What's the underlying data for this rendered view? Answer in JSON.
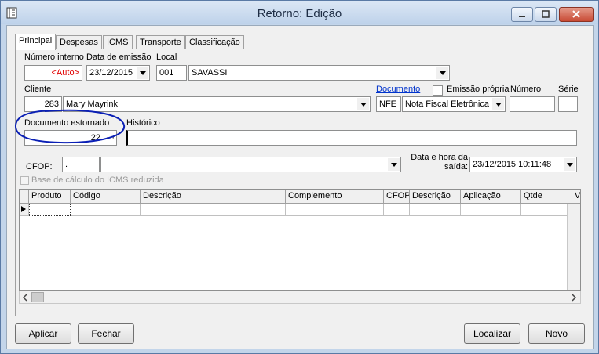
{
  "window": {
    "title": "Retorno: Edição"
  },
  "tabs": [
    "Principal",
    "Despesas",
    "ICMS",
    "Transporte",
    "Classificação"
  ],
  "form": {
    "numero_interno_label": "Número interno",
    "numero_interno_value": "<Auto>",
    "data_emissao_label": "Data de emissão",
    "data_emissao_value": "23/12/2015",
    "local_label": "Local",
    "local_code": "001",
    "local_name": "SAVASSI",
    "cliente_label": "Cliente",
    "cliente_code": "283",
    "cliente_name": "Mary Mayrink",
    "documento_link": "Documento",
    "emissao_propria_label": "Emissão própria",
    "numero_label": "Número",
    "serie_label": "Série",
    "documento_code": "NFE",
    "documento_name": "Nota Fiscal Eletrônica",
    "doc_estornado_label": "Documento estornado",
    "doc_estornado_value": "22",
    "ellipsis": "···",
    "historico_label": "Histórico",
    "historico_value": "",
    "cfop_label": "CFOP:",
    "cfop_code": ".",
    "cfop_desc": "",
    "data_hora_label_1": "Data e hora da",
    "data_hora_label_2": "saída:",
    "data_hora_value": "23/12/2015 10:11:48",
    "base_calculo_label": "Base de cálculo do ICMS reduzida"
  },
  "grid": {
    "columns": [
      "Produto",
      "Código",
      "Descrição",
      "Complemento",
      "CFOP",
      "Descrição",
      "Aplicação",
      "Qtde",
      "V"
    ]
  },
  "buttons": {
    "aplicar": "Aplicar",
    "fechar": "Fechar",
    "localizar": "Localizar",
    "novo": "Novo"
  },
  "colors": {
    "auto_text": "#e00000",
    "link": "#0033cc",
    "annotation": "#0a1fb5"
  }
}
